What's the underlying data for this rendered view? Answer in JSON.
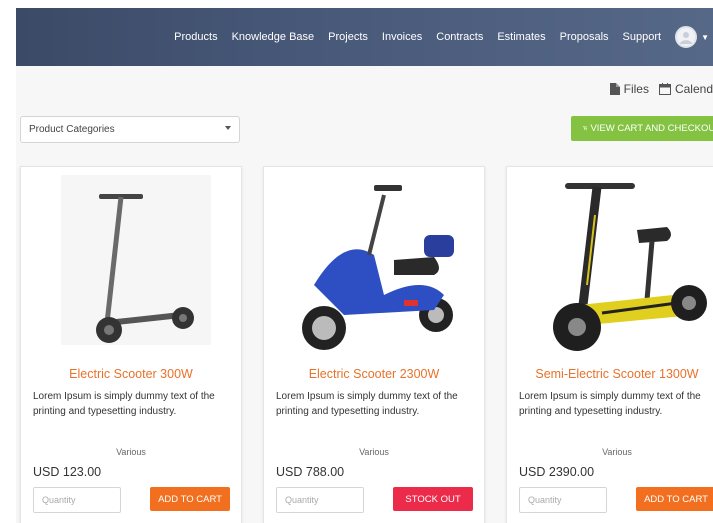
{
  "header": {
    "nav": [
      "Products",
      "Knowledge Base",
      "Projects",
      "Invoices",
      "Contracts",
      "Estimates",
      "Proposals",
      "Support"
    ]
  },
  "utility_links": {
    "files": "Files",
    "calendar": "Calend"
  },
  "filters": {
    "category_select": "Product Categories"
  },
  "checkout_button": "VIEW CART AND CHECKOUT",
  "products": [
    {
      "title": "Electric Scooter 300W",
      "description": "Lorem Ipsum is simply dummy text of the printing and typesetting industry.",
      "category": "Various",
      "price": "USD 123.00",
      "quantity_placeholder": "Quantity",
      "action": "ADD TO CART",
      "action_color": "#f26f1f"
    },
    {
      "title": "Electric Scooter 2300W",
      "description": "Lorem Ipsum is simply dummy text of the printing and typesetting industry.",
      "category": "Various",
      "price": "USD 788.00",
      "quantity_placeholder": "Quantity",
      "action": "STOCK OUT",
      "action_color": "#ec2a4a"
    },
    {
      "title": "Semi-Electric Scooter 1300W",
      "description": "Lorem Ipsum is simply dummy text of the printing and typesetting industry.",
      "category": "Various",
      "price": "USD 2390.00",
      "quantity_placeholder": "Quantity",
      "action": "ADD TO CART",
      "action_color": "#f26f1f"
    }
  ],
  "colors": {
    "header": "#49597a",
    "title_accent": "#e8722b",
    "checkout_green": "#84c341"
  }
}
